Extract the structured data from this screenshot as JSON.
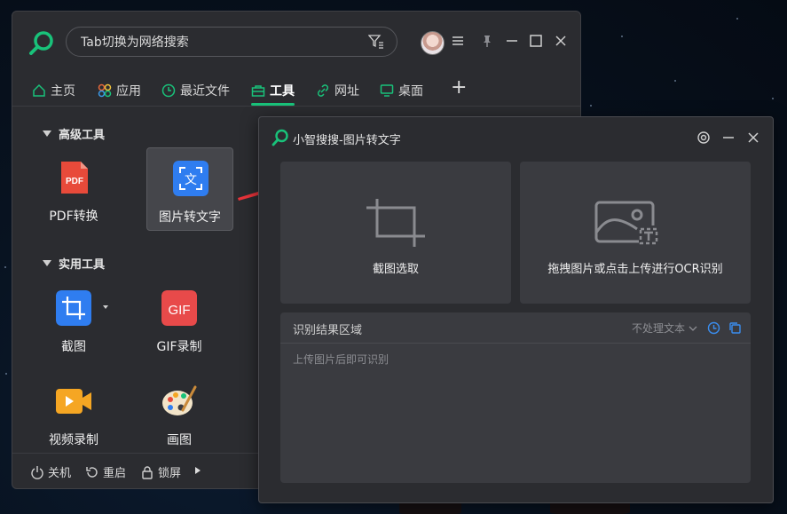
{
  "search": {
    "placeholder": "Tab切换为网络搜索"
  },
  "nav": {
    "tabs": [
      {
        "label": "主页",
        "icon": "home-icon"
      },
      {
        "label": "应用",
        "icon": "apps-icon"
      },
      {
        "label": "最近文件",
        "icon": "clock-icon"
      },
      {
        "label": "工具",
        "icon": "toolbox-icon",
        "active": true
      },
      {
        "label": "网址",
        "icon": "link-icon"
      },
      {
        "label": "桌面",
        "icon": "monitor-icon"
      }
    ],
    "add_symbol": "+"
  },
  "sections": {
    "advanced": "高级工具",
    "practical": "实用工具"
  },
  "tools": {
    "pdf": {
      "label": "PDF转换",
      "icon_text": "PDF"
    },
    "img2text": {
      "label": "图片转文字",
      "icon_text": "文"
    },
    "screenshot": {
      "label": "截图"
    },
    "gif": {
      "label": "GIF录制",
      "icon_text": "GIF"
    },
    "video": {
      "label": "视频录制"
    },
    "paint": {
      "label": "画图"
    }
  },
  "bottom": {
    "shutdown": "关机",
    "restart": "重启",
    "lock": "锁屏"
  },
  "ocr": {
    "title": "小智搜搜-图片转文字",
    "crop_caption": "截图选取",
    "upload_caption": "拖拽图片或点击上传进行OCR识别",
    "result_title": "识别结果区域",
    "result_mode": "不处理文本",
    "result_placeholder": "上传图片后即可识别"
  },
  "colors": {
    "accent": "#19c27a",
    "window_bg": "#2b2c30",
    "card_bg": "#3a3b40",
    "arrow": "#e8333a"
  }
}
